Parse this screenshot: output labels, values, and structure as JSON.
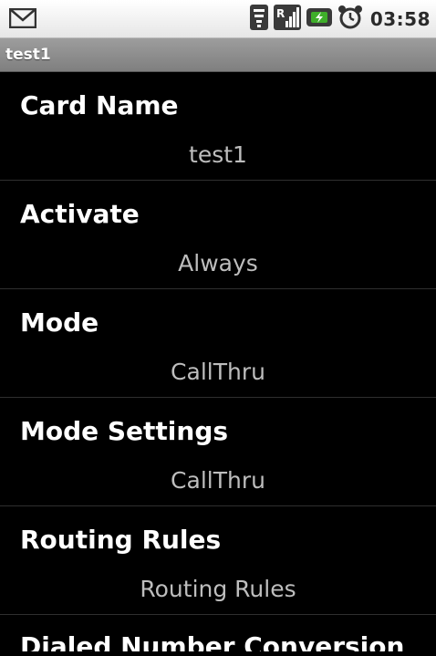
{
  "status_bar": {
    "left_icon": "gmail-icon",
    "icons": [
      "wifi-icon",
      "signal-icon",
      "battery-icon",
      "alarm-icon"
    ],
    "time": "03:58"
  },
  "title_bar": {
    "title": "test1"
  },
  "preferences": [
    {
      "title": "Card Name",
      "summary": "test1"
    },
    {
      "title": "Activate",
      "summary": "Always"
    },
    {
      "title": "Mode",
      "summary": "CallThru"
    },
    {
      "title": "Mode Settings",
      "summary": "CallThru"
    },
    {
      "title": "Routing Rules",
      "summary": "Routing Rules"
    },
    {
      "title": "Dialed Number Conversion"
    }
  ],
  "colors": {
    "background": "#000000",
    "title_bar": "#8a8a8a",
    "status_bar": "#f2f2f2",
    "summary_text": "#bdbdbd",
    "battery_green": "#3fae2a"
  }
}
